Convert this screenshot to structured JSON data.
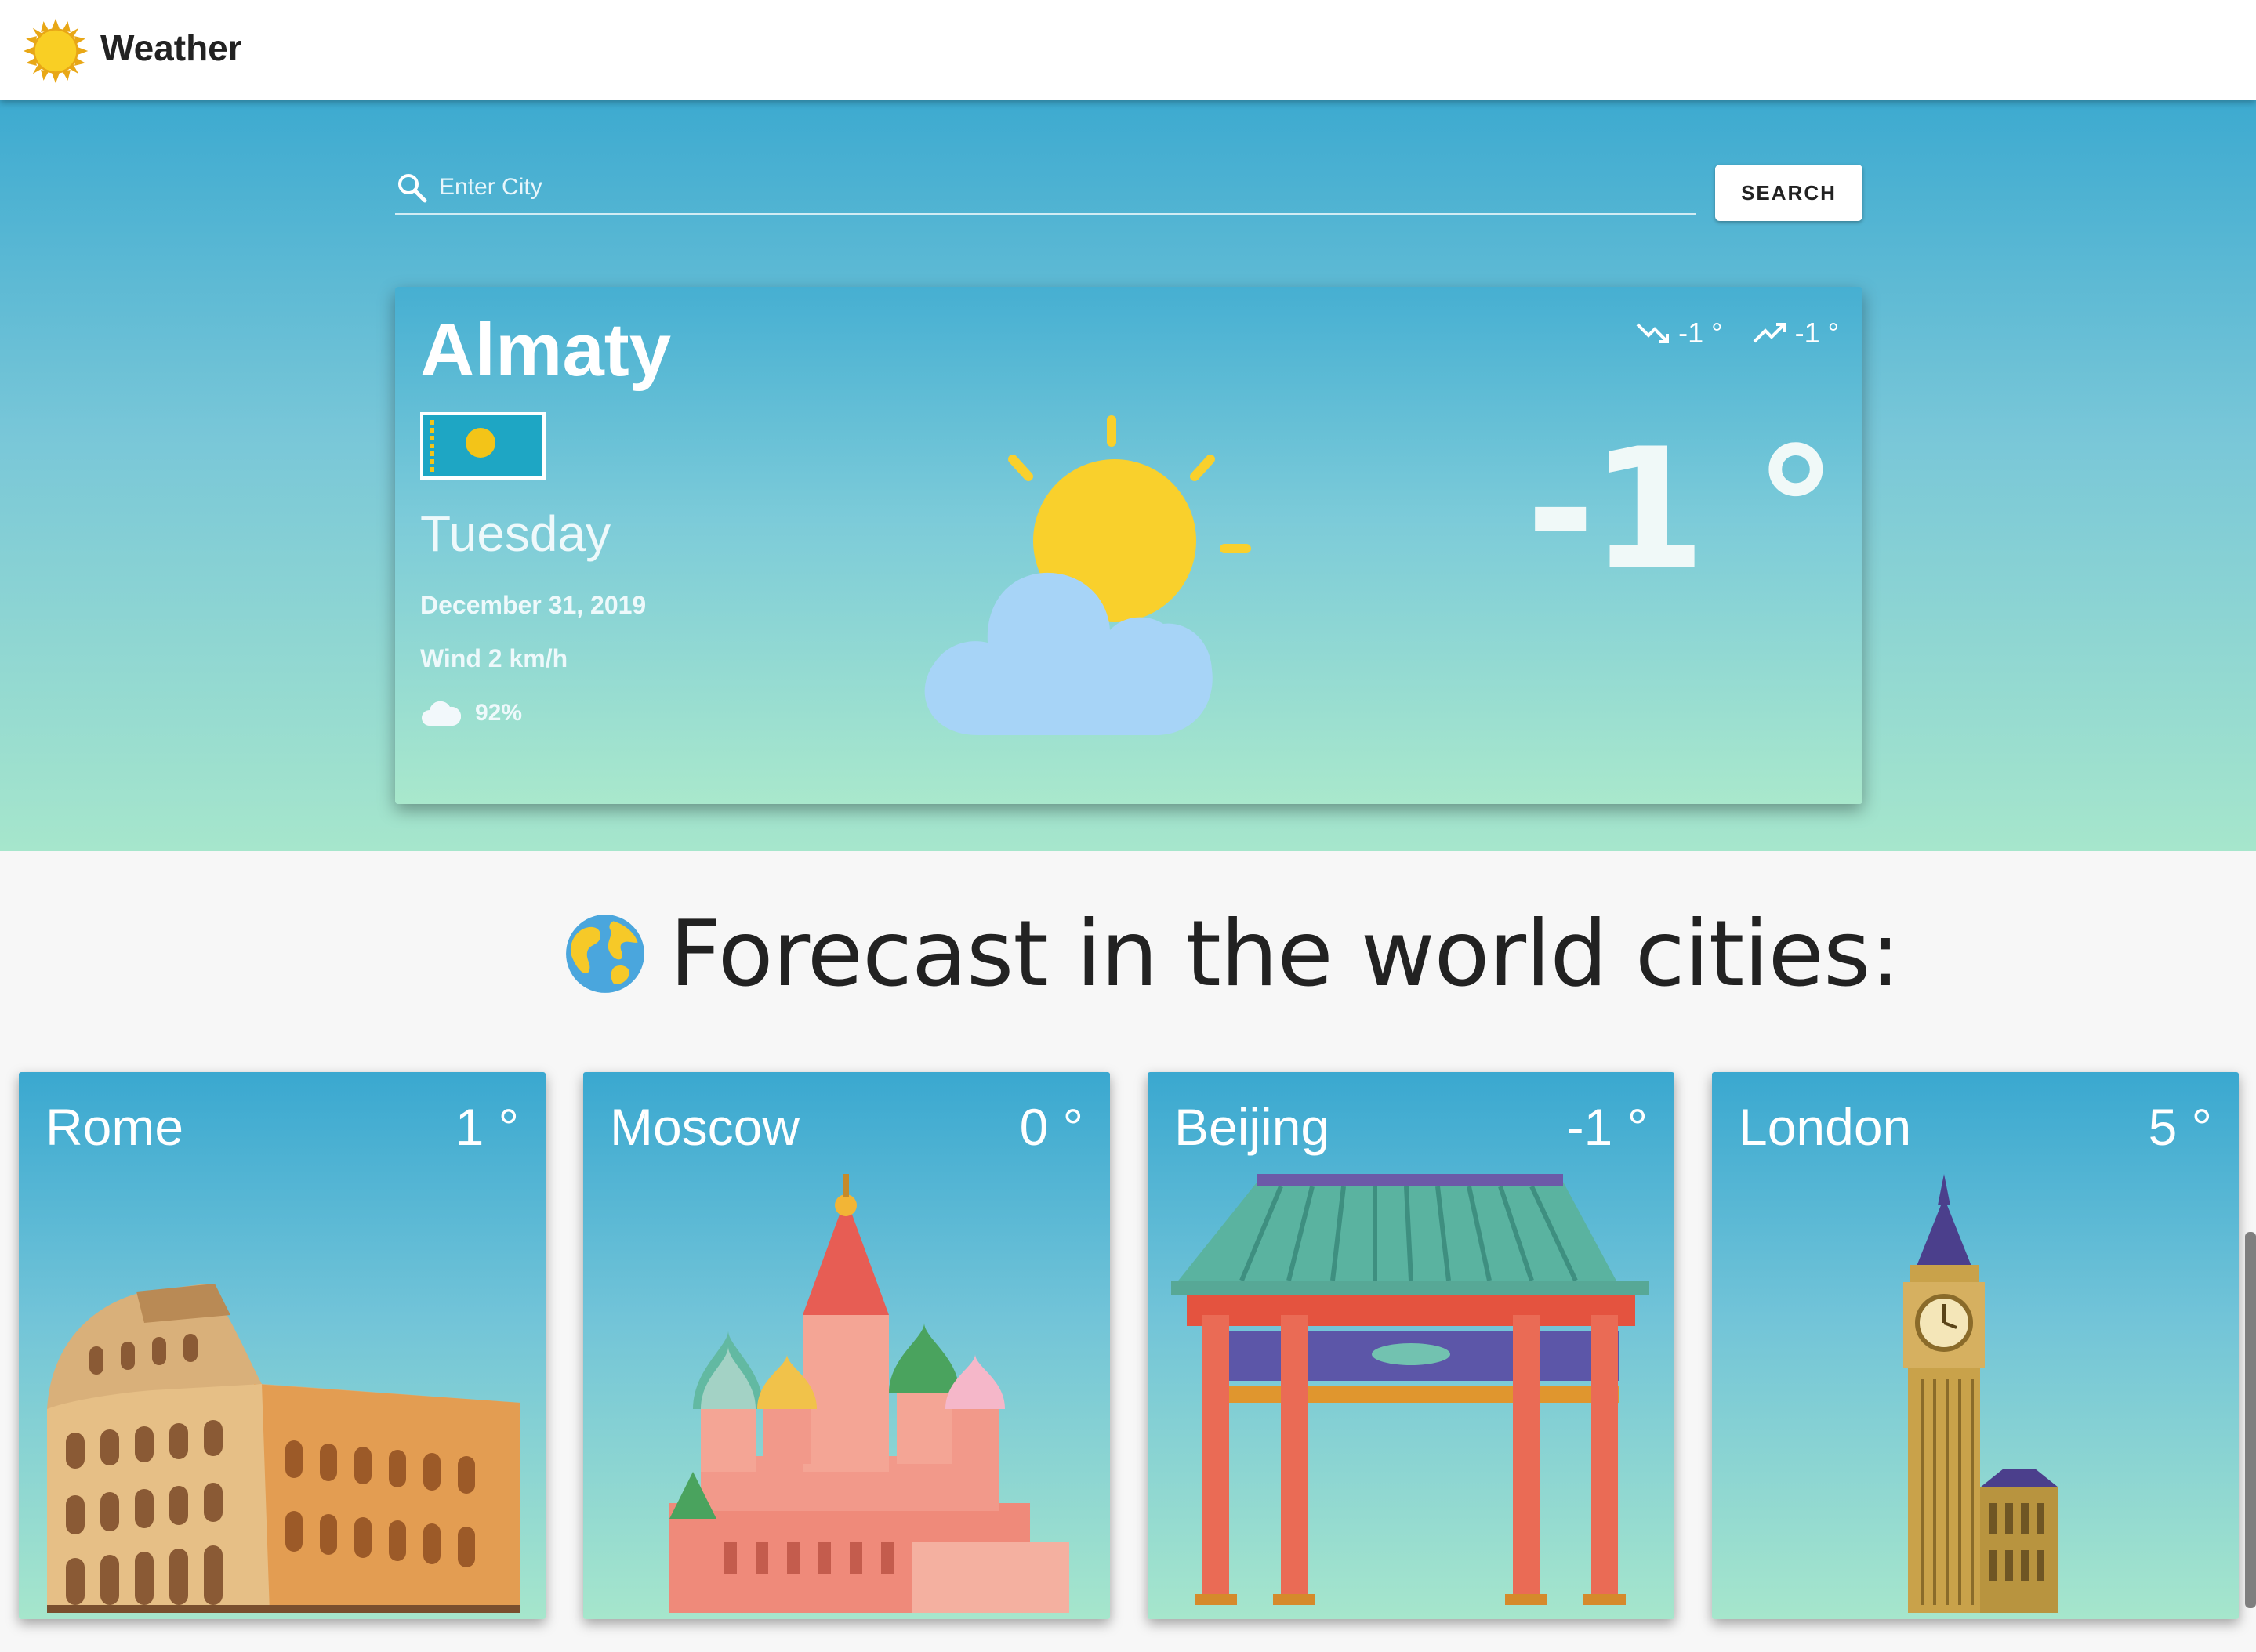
{
  "app": {
    "title": "Weather",
    "logo_icon": "sun-icon"
  },
  "search": {
    "placeholder": "Enter City",
    "button_label": "SEARCH"
  },
  "current": {
    "city": "Almaty",
    "flag": "kazakhstan-flag",
    "weekday": "Tuesday",
    "date": "December 31, 2019",
    "wind": "Wind 2 km/h",
    "humidity": "92%",
    "min_temp": "-1 °",
    "max_temp": "-1 °",
    "temperature": "-1 °",
    "condition_icon": "partly-cloudy-icon"
  },
  "forecast": {
    "title": "Forecast in the world cities:",
    "icon": "globe-icon",
    "cities": [
      {
        "name": "Rome",
        "temp": "1 °",
        "landmark": "colosseum"
      },
      {
        "name": "Moscow",
        "temp": "0 °",
        "landmark": "saint-basils-cathedral"
      },
      {
        "name": "Beijing",
        "temp": "-1 °",
        "landmark": "chinese-gate"
      },
      {
        "name": "London",
        "temp": "5 °",
        "landmark": "big-ben"
      }
    ]
  },
  "colors": {
    "hero_top": "#3daad0",
    "hero_bottom": "#a6e6cc",
    "sun": "#f9d02c",
    "cloud": "#a7d4f7"
  }
}
